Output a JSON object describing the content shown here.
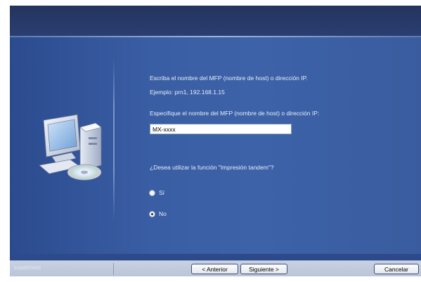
{
  "instructions": {
    "line1": "Escriba el nombre del MFP (nombre de host) o dirección IP.",
    "line2": "Ejemplo: prn1, 192.168.1.15",
    "line3": "Especifique el nombre del MFP (nombre de host) o dirección IP:"
  },
  "host_field": {
    "value": "MX-xxxx"
  },
  "tandem": {
    "question": "¿Desea utilizar la función \"Impresión tandem\"?",
    "options": [
      {
        "label": "Sí",
        "checked": false
      },
      {
        "label": "No",
        "checked": true
      }
    ]
  },
  "footer": {
    "brand": "InstallShield",
    "back_label": "< Anterior",
    "next_label": "Siguiente >",
    "cancel_label": "Cancelar"
  },
  "icons": [
    "computer-cd-icon",
    "radio-icon"
  ]
}
